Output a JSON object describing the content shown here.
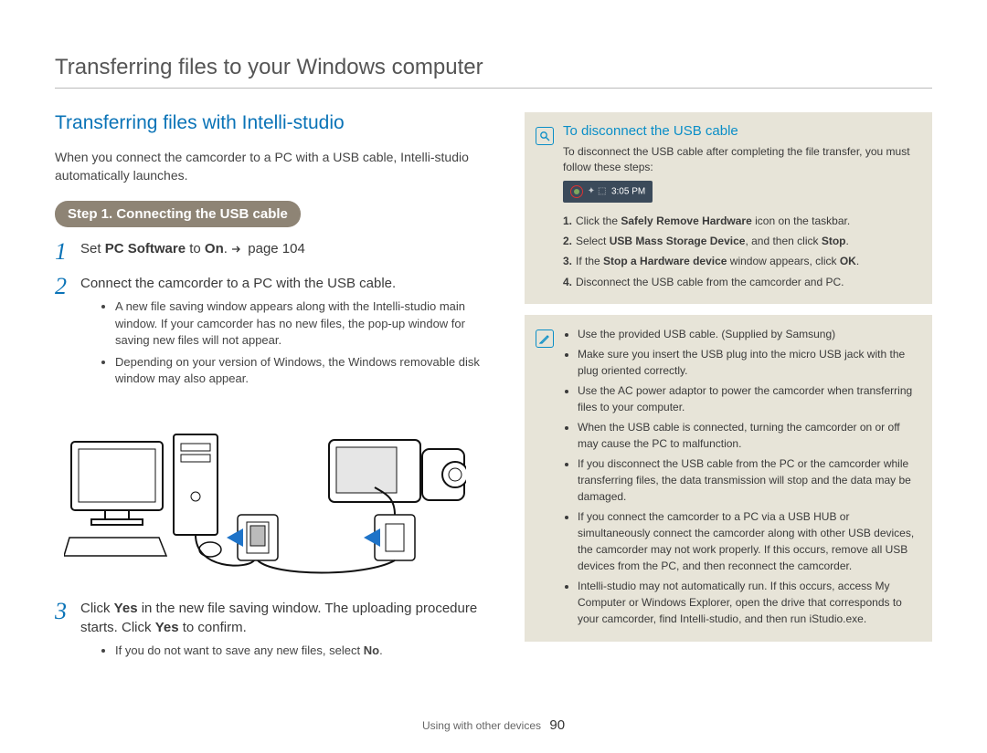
{
  "pageTitle": "Transferring files to your Windows computer",
  "sectionTitle": "Transferring files with Intelli-studio",
  "intro": "When you connect the camcorder to a PC with a USB cable, Intelli-studio automatically launches.",
  "stepPill": "Step 1. Connecting the USB cable",
  "steps": {
    "s1": {
      "num": "1",
      "pre": "Set ",
      "b1": "PC Software",
      "mid": " to ",
      "b2": "On",
      "post": ".  ",
      "ref": "page 104"
    },
    "s2": {
      "num": "2",
      "text": "Connect the camcorder to a PC with the USB cable.",
      "bullets": [
        "A new file saving window appears along with the Intelli-studio main window. If your camcorder has no new files, the pop-up window for saving new files will not appear.",
        "Depending on your version of Windows, the Windows removable disk window may also appear."
      ]
    },
    "s3": {
      "num": "3",
      "parts": {
        "pre": "Click ",
        "b1": "Yes",
        "mid1": " in the new file saving window. The uploading procedure starts. Click ",
        "b2": "Yes",
        "post": " to confirm."
      },
      "bullets_pre": "If you do not want to save any new files, select ",
      "bullets_b": "No",
      "bullets_post": "."
    }
  },
  "disconnect": {
    "title": "To disconnect the USB cable",
    "intro": "To disconnect the USB cable after completing the file transfer, you must follow these steps:",
    "trayTime": "3:05 PM",
    "ol": [
      {
        "n": "1.",
        "pre": "Click the ",
        "b1": "Safely Remove Hardware",
        "post": " icon on the taskbar."
      },
      {
        "n": "2.",
        "pre": "Select ",
        "b1": "USB Mass Storage Device",
        "mid": ", and then click ",
        "b2": "Stop",
        "post": "."
      },
      {
        "n": "3.",
        "pre": "If the ",
        "b1": "Stop a Hardware device",
        "mid": " window appears, click ",
        "b2": "OK",
        "post": "."
      },
      {
        "n": "4.",
        "pre": "Disconnect the USB cable from the camcorder and PC."
      }
    ]
  },
  "notes": [
    "Use the provided USB cable. (Supplied by Samsung)",
    "Make sure you insert the USB plug into the micro USB jack with the plug oriented correctly.",
    "Use the AC power adaptor to power the camcorder when transferring files to your computer.",
    "When the USB cable is connected, turning the camcorder on or off may cause the PC to malfunction.",
    "If you disconnect the USB cable from the PC or the camcorder while transferring files, the data transmission will stop and the data may be damaged.",
    "If you connect the camcorder to a PC via a USB HUB or simultaneously connect the camcorder along with other USB devices, the camcorder may not work properly. If this occurs, remove all USB devices from the PC, and then reconnect the camcorder.",
    "Intelli-studio may not automatically run. If this occurs, access My Computer or Windows Explorer, open the drive that corresponds to your camcorder, find Intelli-studio, and then run iStudio.exe."
  ],
  "footer": {
    "chapter": "Using with other devices",
    "page": "90"
  }
}
